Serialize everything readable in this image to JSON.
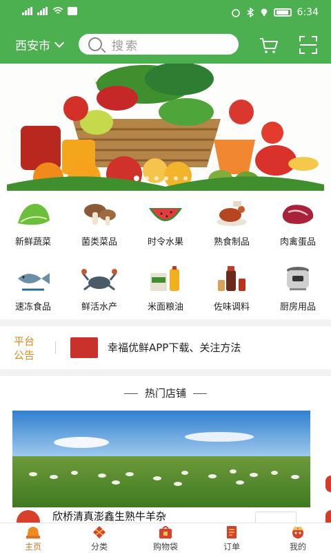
{
  "status": {
    "time": "6:34"
  },
  "header": {
    "city": "西安市",
    "search_placeholder": "搜索"
  },
  "categories": [
    {
      "label": "新鲜蔬菜",
      "icon": "vegetable-icon"
    },
    {
      "label": "菌类菜品",
      "icon": "mushroom-icon"
    },
    {
      "label": "时令水果",
      "icon": "watermelon-icon"
    },
    {
      "label": "熟食制品",
      "icon": "roast-duck-icon"
    },
    {
      "label": "肉禽蛋品",
      "icon": "meat-icon"
    },
    {
      "label": "速冻食品",
      "icon": "frozen-fish-icon"
    },
    {
      "label": "鲜活水产",
      "icon": "crab-icon"
    },
    {
      "label": "米面粮油",
      "icon": "rice-oil-icon"
    },
    {
      "label": "佐味调料",
      "icon": "seasoning-icon"
    },
    {
      "label": "厨房用品",
      "icon": "rice-cooker-icon"
    }
  ],
  "notice": {
    "tag": "平台公告",
    "message": "幸福优鲜APP下载、关注方法"
  },
  "hot": {
    "title": "热门店铺",
    "shop_name": "欣桥清真澎鑫生熟牛羊杂"
  },
  "tabs": [
    {
      "label": "主页",
      "active": true
    },
    {
      "label": "分类",
      "active": false
    },
    {
      "label": "购物袋",
      "active": false
    },
    {
      "label": "订单",
      "active": false
    },
    {
      "label": "我的",
      "active": false
    }
  ],
  "colors": {
    "brand": "#4caf50",
    "accent": "#e0701e"
  }
}
